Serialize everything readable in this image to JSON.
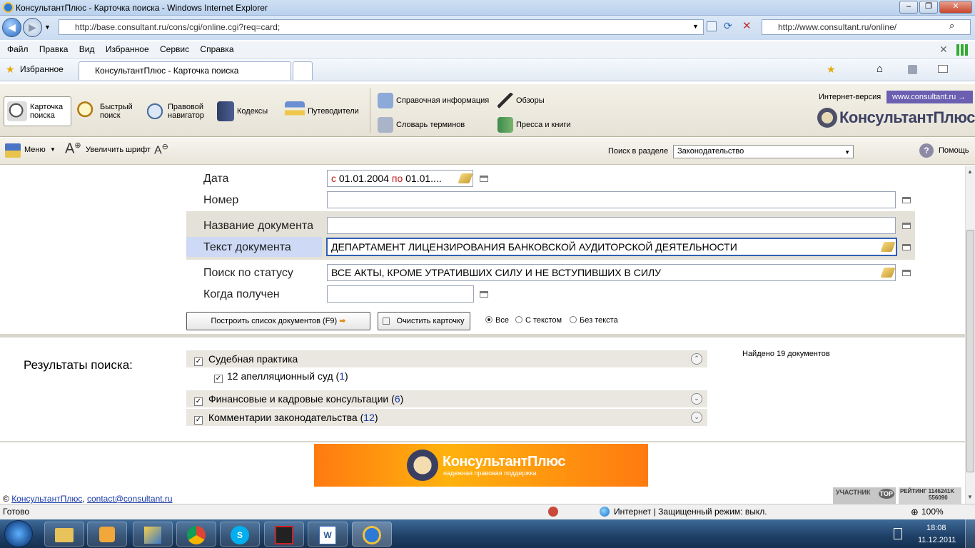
{
  "window": {
    "title": "КонсультантПлюс - Карточка поиска - Windows Internet Explorer"
  },
  "address": {
    "url": "http://base.consultant.ru/cons/cgi/online.cgi?req=card;",
    "search_url": "http://www.consultant.ru/online/"
  },
  "menu": [
    "Файл",
    "Правка",
    "Вид",
    "Избранное",
    "Сервис",
    "Справка"
  ],
  "favbar": {
    "favorites": "Избранное",
    "tab": "КонсультантПлюс - Карточка поиска"
  },
  "toolbar": {
    "items": [
      {
        "l1": "Карточка",
        "l2": "поиска"
      },
      {
        "l1": "Быстрый",
        "l2": "поиск"
      },
      {
        "l1": "Правовой",
        "l2": "навигатор"
      },
      {
        "l1": "Кодексы",
        "l2": ""
      },
      {
        "l1": "Путеводители",
        "l2": ""
      }
    ],
    "links": [
      "Справочная информация",
      "Словарь терминов",
      "Обзоры",
      "Пресса и книги"
    ],
    "internet_version": "Интернет-версия",
    "site": "www.consultant.ru →",
    "logo": "КонсультантПлюс"
  },
  "toolbar2": {
    "menu": "Меню",
    "enlarge": "Увеличить шрифт",
    "search_in": "Поиск в разделе",
    "section": "Законодательство",
    "help": "Помощь"
  },
  "card": {
    "date_label": "Дата",
    "date_from_kw": "с",
    "date_from": "01.01.2004",
    "date_to_kw": "по",
    "date_to": "01.01....",
    "number_label": "Номер",
    "name_label": "Название документа",
    "text_label": "Текст документа",
    "text_value": "ДЕПАРТАМЕНТ ЛИЦЕНЗИРОВАНИЯ БАНКОВСКОЙ АУДИТОРСКОЙ ДЕЯТЕЛЬНОСТИ",
    "status_label": "Поиск по статусу",
    "status_value": "ВСЕ АКТЫ, КРОМЕ УТРАТИВШИХ СИЛУ И НЕ ВСТУПИВШИХ В СИЛУ",
    "received_label": "Когда получен",
    "build_button": "Построить список документов (F9)",
    "clear_button": "Очистить карточку",
    "radio_all": "Все",
    "radio_text": "С текстом",
    "radio_notext": "Без текста"
  },
  "results": {
    "title": "Результаты поиска:",
    "found": "Найдено 19 документов",
    "groups": [
      {
        "name": "Судебная практика",
        "count": ""
      },
      {
        "name": "12 апелляционный суд",
        "count": "1"
      },
      {
        "name": "Финансовые и кадровые консультации",
        "count": "6"
      },
      {
        "name": "Комментарии законодательства",
        "count": "12"
      }
    ]
  },
  "banner": {
    "title": "КонсультантПлюс",
    "subtitle": "надежная правовая поддержка"
  },
  "footer": {
    "copy": "©",
    "link1": "КонсультантПлюс",
    "link2": "contact@consultant.ru",
    "badge1": "УЧАСТНИК",
    "badge2": "TOP",
    "rating": "РЕЙТИНГ",
    "r1": "1146241K",
    "r2": "556090"
  },
  "status": {
    "left": "Готово",
    "zone": "Интернет | Защищенный режим: выкл.",
    "zoom": "100%"
  },
  "tray": {
    "time": "18:08",
    "date": "11.12.2011"
  },
  "colors": {
    "accent": "#2f5fb3",
    "highlight": "#cdd9f5",
    "band": "#e4e1d8"
  }
}
